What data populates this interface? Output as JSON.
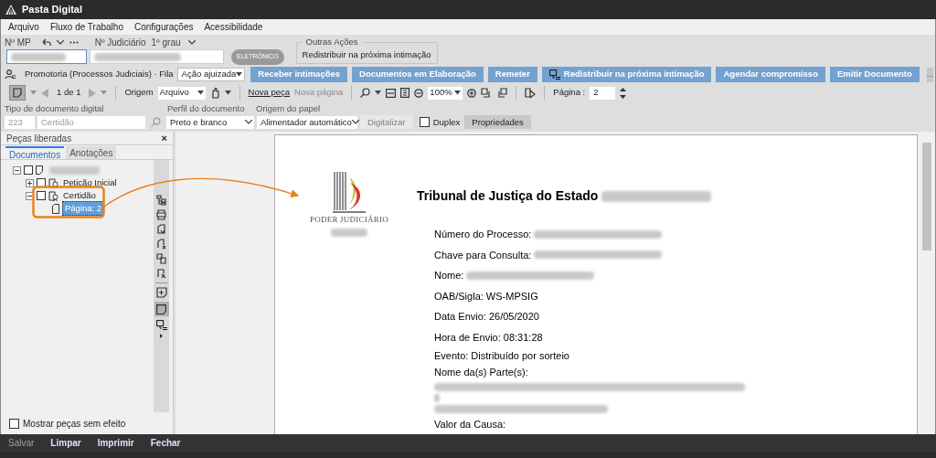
{
  "window": {
    "title": "Pasta Digital"
  },
  "menu": [
    {
      "label": "Arquivo"
    },
    {
      "label": "Fluxo de Trabalho"
    },
    {
      "label": "Configurações"
    },
    {
      "label": "Acessibilidade"
    }
  ],
  "header": {
    "mp_label": "Nº MP",
    "judicial_label": "Nº Judiciário",
    "instance": "1º grau",
    "badge": "ELETRÔNICO",
    "other_actions": {
      "title": "Outras Ações",
      "text": "Redistribuir na próxima intimação"
    }
  },
  "queue": {
    "label": "Promotoria (Processos Judiciais) · Fila",
    "value": "Ação ajuizada"
  },
  "actions": [
    {
      "label": "Receber intimações",
      "kind": "plain"
    },
    {
      "label": "Documentos em Elaboração",
      "kind": "plain"
    },
    {
      "label": "Remeter",
      "kind": "plain"
    },
    {
      "label": "Redistribuir na próxima intimação",
      "kind": "icon"
    },
    {
      "label": "Agendar compromisso",
      "kind": "plain"
    },
    {
      "label": "Emitir Documento",
      "kind": "plain"
    }
  ],
  "more_button": "...",
  "toolbar": {
    "pager": "1 de 1",
    "origin_label": "Origem",
    "origin": "Arquivo",
    "new_piece": {
      "label": "Nova peça",
      "disabled": false
    },
    "new_page": {
      "label": "Nova página",
      "disabled": true
    },
    "zoom": "100%",
    "page_label": "Página :",
    "page": "2"
  },
  "scan": {
    "type_label": "Tipo de documento digital",
    "type_code": "223",
    "type_name": "Certidão",
    "profile_label": "Perfil do documento",
    "profile": "Preto e branco",
    "paper_label": "Origem do papel",
    "paper": "Alimentador automático",
    "scan_button": {
      "label": "Digitalizar",
      "disabled": true
    },
    "duplex": {
      "label": "Duplex",
      "checked": false
    },
    "properties": "Propriedades"
  },
  "panel": {
    "title": "Peças liberadas",
    "close": "×",
    "tabs": [
      {
        "label": "Documentos",
        "selected": true
      },
      {
        "label": "Anotações",
        "selected": false
      }
    ],
    "tree": [
      {
        "kind": "folder",
        "redacted": true,
        "checked": false,
        "expanded": true,
        "children": [
          {
            "kind": "piece",
            "label": "Petição Inicial",
            "checked": false,
            "expanded": false
          },
          {
            "kind": "piece",
            "label": "Certidão",
            "checked": false,
            "expanded": true,
            "children": [
              {
                "kind": "page",
                "label": "Página: 2",
                "selected": true
              }
            ]
          }
        ]
      }
    ],
    "show_void": {
      "label": "Mostrar peças sem efeito",
      "checked": false
    }
  },
  "document": {
    "logo": "PODER JUDICIÁRIO",
    "title": "Tribunal de Justiça do Estado",
    "title_redacted": true,
    "lines": [
      {
        "kind": "field",
        "label": "Número do Processo:",
        "redacted": true
      },
      {
        "kind": "field",
        "label": "Chave para Consulta:",
        "redacted": true
      },
      {
        "kind": "field",
        "label": "Nome:",
        "redacted": true
      },
      {
        "kind": "field",
        "label": "OAB/Sigla: WS-MPSIG",
        "redacted": false
      },
      {
        "kind": "field",
        "label": "Data Envio: 26/05/2020",
        "redacted": false
      },
      {
        "kind": "field",
        "label": "Hora de Envio: 08:31:28",
        "redacted": false
      },
      {
        "kind": "tight",
        "label": "Evento: Distribuído por sorteio",
        "redacted": false
      },
      {
        "kind": "tight",
        "label": "Nome da(s) Parte(s):",
        "redacted": false
      },
      {
        "kind": "redacted_block"
      },
      {
        "kind": "tight",
        "label": "Valor da Causa:",
        "redacted": false
      }
    ]
  },
  "footer": [
    {
      "label": "Salvar",
      "disabled": true
    },
    {
      "label": "Limpar",
      "disabled": false
    },
    {
      "label": "Imprimir",
      "disabled": false
    },
    {
      "label": "Fechar",
      "disabled": false
    }
  ]
}
